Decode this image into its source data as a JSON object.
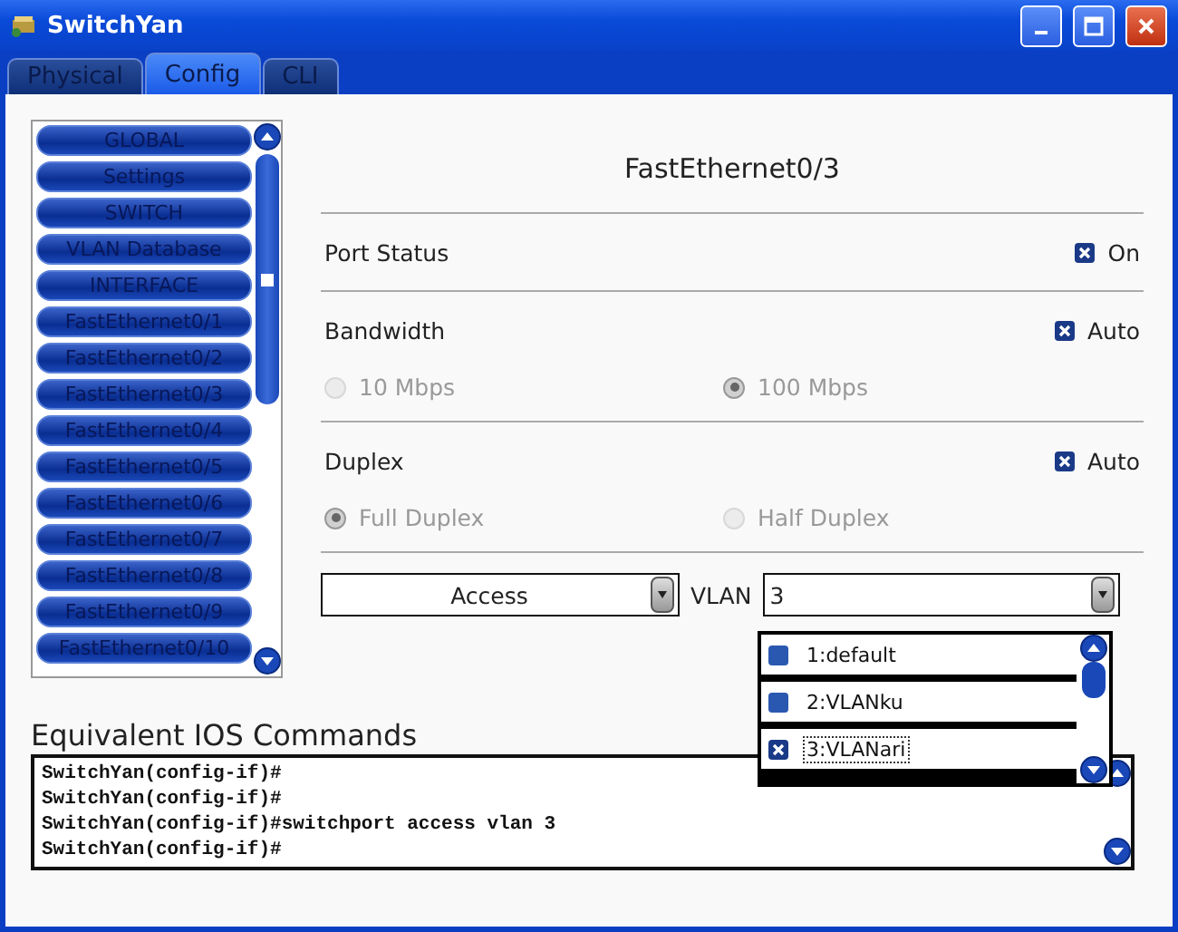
{
  "window": {
    "title": "SwitchYan"
  },
  "tabs": [
    {
      "label": "Physical",
      "selected": false
    },
    {
      "label": "Config",
      "selected": true
    },
    {
      "label": "CLI",
      "selected": false
    }
  ],
  "sidebar": {
    "items": [
      "GLOBAL",
      "Settings",
      "SWITCH",
      "VLAN Database",
      "INTERFACE",
      "FastEthernet0/1",
      "FastEthernet0/2",
      "FastEthernet0/3",
      "FastEthernet0/4",
      "FastEthernet0/5",
      "FastEthernet0/6",
      "FastEthernet0/7",
      "FastEthernet0/8",
      "FastEthernet0/9",
      "FastEthernet0/10"
    ]
  },
  "panel": {
    "heading": "FastEthernet0/3",
    "port_status": {
      "label": "Port Status",
      "toggle": {
        "label": "On",
        "checked": true
      }
    },
    "bandwidth": {
      "label": "Bandwidth",
      "auto": {
        "label": "Auto",
        "checked": true
      },
      "disabled": true,
      "options": [
        {
          "label": "10 Mbps",
          "selected": false
        },
        {
          "label": "100 Mbps",
          "selected": true
        }
      ]
    },
    "duplex": {
      "label": "Duplex",
      "auto": {
        "label": "Auto",
        "checked": true
      },
      "disabled": true,
      "options": [
        {
          "label": "Full Duplex",
          "selected": true
        },
        {
          "label": "Half Duplex",
          "selected": false
        }
      ]
    },
    "mode_select": {
      "value": "Access"
    },
    "vlan_label": "VLAN",
    "vlan_select": {
      "value": "3"
    },
    "vlan_list": [
      {
        "label": "1:default",
        "checked": false
      },
      {
        "label": "2:VLANku",
        "checked": false
      },
      {
        "label": "3:VLANari",
        "checked": true
      }
    ]
  },
  "commands": {
    "title": "Equivalent IOS Commands",
    "lines": [
      "SwitchYan(config-if)#",
      "SwitchYan(config-if)#",
      "SwitchYan(config-if)#switchport access vlan 3",
      "SwitchYan(config-if)#"
    ]
  }
}
